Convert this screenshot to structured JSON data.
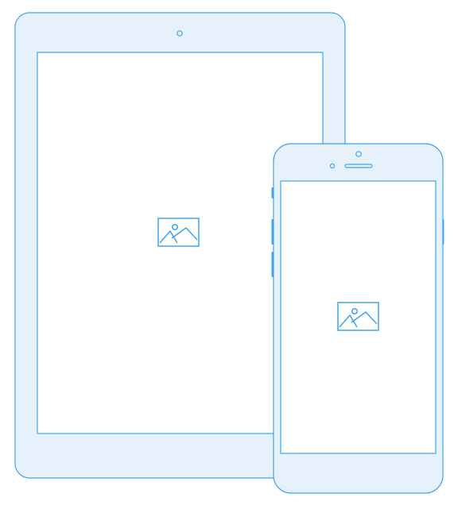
{
  "illustration": {
    "devices": [
      {
        "kind": "tablet",
        "screen_content": "image-placeholder-icon"
      },
      {
        "kind": "phone",
        "screen_content": "image-placeholder-icon"
      }
    ]
  },
  "colors": {
    "outline": "#3ea3ee",
    "body_fill": "#e6f1fc",
    "screen_fill": "#ffffff",
    "button_accent": "#3ea3ee"
  }
}
